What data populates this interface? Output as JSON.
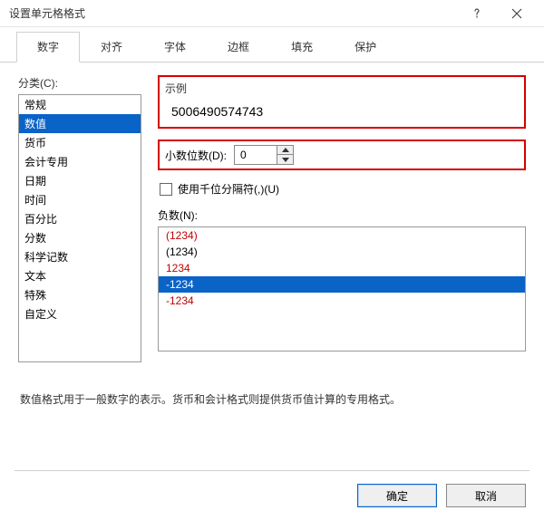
{
  "window": {
    "title": "设置单元格格式"
  },
  "tabs": [
    "数字",
    "对齐",
    "字体",
    "边框",
    "填充",
    "保护"
  ],
  "active_tab_index": 0,
  "category": {
    "label": "分类(C):",
    "items": [
      "常规",
      "数值",
      "货币",
      "会计专用",
      "日期",
      "时间",
      "百分比",
      "分数",
      "科学记数",
      "文本",
      "特殊",
      "自定义"
    ],
    "selected_index": 1
  },
  "sample": {
    "label": "示例",
    "value": "5006490574743"
  },
  "decimals": {
    "label": "小数位数(D):",
    "value": "0"
  },
  "thousands": {
    "label": "使用千位分隔符(,)(U)",
    "checked": false
  },
  "negative": {
    "label": "负数(N):",
    "items": [
      {
        "text": "(1234)",
        "cls": "red"
      },
      {
        "text": "(1234)",
        "cls": "blk"
      },
      {
        "text": "1234",
        "cls": "red"
      },
      {
        "text": "-1234",
        "cls": "sel"
      },
      {
        "text": "-1234",
        "cls": "red"
      }
    ]
  },
  "description": "数值格式用于一般数字的表示。货币和会计格式则提供货币值计算的专用格式。",
  "buttons": {
    "ok": "确定",
    "cancel": "取消"
  }
}
